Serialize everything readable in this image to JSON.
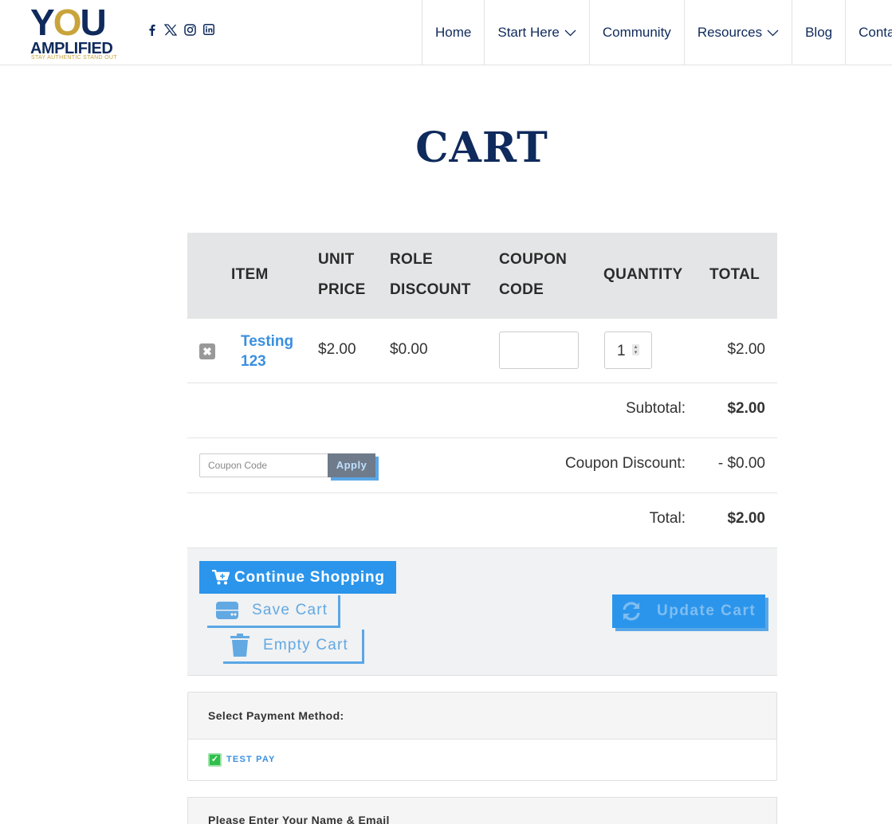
{
  "header": {
    "logo": {
      "you_text": "YOU",
      "amplified_text": "AMPLIFIED",
      "tagline": "STAY AUTHENTIC STAND OUT"
    },
    "social": [
      "facebook-icon",
      "x-icon",
      "instagram-icon",
      "linkedin-icon"
    ],
    "nav": [
      {
        "label": "Home",
        "dropdown": false
      },
      {
        "label": "Start Here",
        "dropdown": true
      },
      {
        "label": "Community",
        "dropdown": false
      },
      {
        "label": "Resources",
        "dropdown": true
      },
      {
        "label": "Blog",
        "dropdown": false
      },
      {
        "label": "Contact",
        "dropdown": false
      }
    ]
  },
  "page": {
    "title": "CART"
  },
  "cart": {
    "headers": {
      "item": "ITEM",
      "unit_price_1": "UNIT",
      "unit_price_2": "PRICE",
      "role_discount_1": "ROLE",
      "role_discount_2": "DISCOUNT",
      "coupon_code_1": "COUPON",
      "coupon_code_2": "CODE",
      "quantity": "QUANTITY",
      "total": "TOTAL"
    },
    "items": [
      {
        "name": "Testing 123",
        "unit_price": "$2.00",
        "role_discount": "$0.00",
        "coupon_code": "",
        "quantity": "1",
        "total": "$2.00"
      }
    ],
    "subtotal_label": "Subtotal:",
    "subtotal_value": "$2.00",
    "coupon_placeholder": "Coupon Code",
    "apply_label": "Apply",
    "coupon_discount_label": "Coupon Discount:",
    "coupon_discount_value": "- $0.00",
    "total_label": "Total:",
    "total_value": "$2.00",
    "buttons": {
      "continue_shopping": "Continue Shopping",
      "save_cart": "Save Cart",
      "empty_cart": "Empty Cart",
      "update_cart": "Update Cart"
    }
  },
  "payment": {
    "heading": "Select Payment Method:",
    "option": "TEST PAY",
    "selected": true
  },
  "info": {
    "heading": "Please Enter Your Name & Email"
  },
  "colors": {
    "navy": "#0f2a5c",
    "gold": "#c9a43c",
    "accent_blue": "#2b95ec",
    "link_blue": "#3a8fe0"
  }
}
